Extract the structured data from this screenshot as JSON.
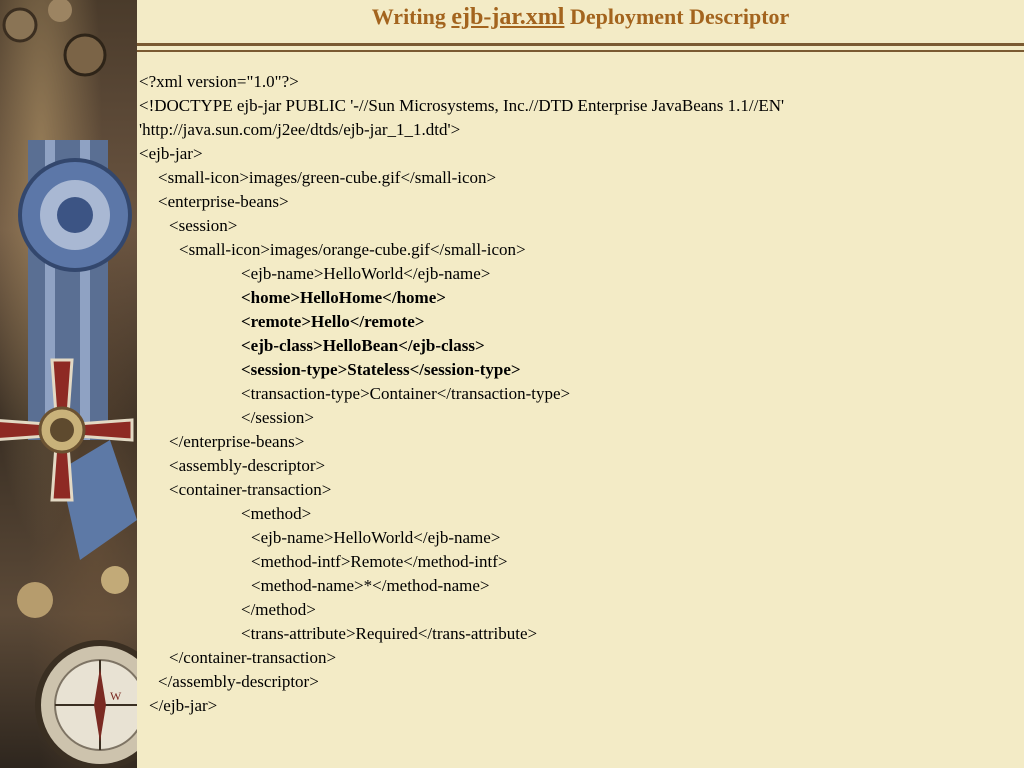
{
  "title": {
    "prefix": "Writing ",
    "filename": "ejb-jar.xml",
    "suffix": " Deployment Descriptor"
  },
  "code_lines": [
    {
      "indent": 0,
      "text": "<?xml version=\"1.0\"?>",
      "bold": false
    },
    {
      "indent": 0,
      "text": "<!DOCTYPE ejb-jar PUBLIC '-//Sun Microsystems, Inc.//DTD Enterprise JavaBeans 1.1//EN'",
      "bold": false
    },
    {
      "indent": 0,
      "text": "'http://java.sun.com/j2ee/dtds/ejb-jar_1_1.dtd'>",
      "bold": false
    },
    {
      "indent": 0,
      "text": "<ejb-jar>",
      "bold": false
    },
    {
      "indent": 19,
      "text": "<small-icon>images/green-cube.gif</small-icon>",
      "bold": false
    },
    {
      "indent": 19,
      "text": "<enterprise-beans>",
      "bold": false
    },
    {
      "indent": 30,
      "text": "<session>",
      "bold": false
    },
    {
      "indent": 40,
      "text": "<small-icon>images/orange-cube.gif</small-icon>",
      "bold": false
    },
    {
      "indent": 102,
      "text": "<ejb-name>HelloWorld</ejb-name>",
      "bold": false
    },
    {
      "indent": 102,
      "text": "<home>HelloHome</home>",
      "bold": true
    },
    {
      "indent": 102,
      "text": "<remote>Hello</remote>",
      "bold": true
    },
    {
      "indent": 102,
      "text": "<ejb-class>HelloBean</ejb-class>",
      "bold": true
    },
    {
      "indent": 102,
      "text": "<session-type>Stateless</session-type>",
      "bold": true
    },
    {
      "indent": 102,
      "text": "<transaction-type>Container</transaction-type>",
      "bold": false
    },
    {
      "indent": 102,
      "text": "</session>",
      "bold": false
    },
    {
      "indent": 30,
      "text": "</enterprise-beans>",
      "bold": false
    },
    {
      "indent": 30,
      "text": "<assembly-descriptor>",
      "bold": false
    },
    {
      "indent": 30,
      "text": "<container-transaction>",
      "bold": false
    },
    {
      "indent": 102,
      "text": "<method>",
      "bold": false
    },
    {
      "indent": 112,
      "text": "<ejb-name>HelloWorld</ejb-name>",
      "bold": false
    },
    {
      "indent": 112,
      "text": "<method-intf>Remote</method-intf>",
      "bold": false
    },
    {
      "indent": 112,
      "text": "<method-name>*</method-name>",
      "bold": false
    },
    {
      "indent": 102,
      "text": "</method>",
      "bold": false
    },
    {
      "indent": 102,
      "text": "<trans-attribute>Required</trans-attribute>",
      "bold": false
    },
    {
      "indent": 30,
      "text": "</container-transaction>",
      "bold": false
    },
    {
      "indent": 19,
      "text": "</assembly-descriptor>",
      "bold": false
    },
    {
      "indent": 10,
      "text": "</ejb-jar>",
      "bold": false
    }
  ]
}
